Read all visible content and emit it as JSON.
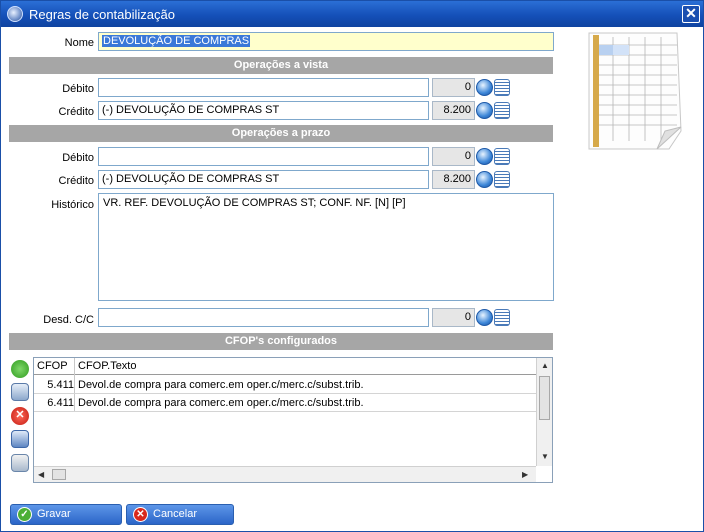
{
  "window": {
    "title": "Regras de contabilização"
  },
  "form": {
    "nome_label": "Nome",
    "nome_value": "DEVOLUÇÃO DE COMPRAS",
    "section_vista": "Operações a vista",
    "section_prazo": "Operações a prazo",
    "debito_label": "Débito",
    "credito_label": "Crédito",
    "vista": {
      "debito_value": "",
      "debito_code": "0",
      "credito_value": "(-) DEVOLUÇÃO DE COMPRAS ST",
      "credito_code": "8.200"
    },
    "prazo": {
      "debito_value": "",
      "debito_code": "0",
      "credito_value": "(-) DEVOLUÇÃO DE COMPRAS ST",
      "credito_code": "8.200"
    },
    "historico_label": "Histórico",
    "historico_value": "VR. REF. DEVOLUÇÃO DE COMPRAS ST; CONF. NF. [N] [P]",
    "desd_label": "Desd. C/C",
    "desd_value": "",
    "desd_code": "0"
  },
  "cfop": {
    "section": "CFOP's configurados",
    "columns": [
      "CFOP",
      "CFOP.Texto"
    ],
    "rows": [
      {
        "cfop": "5.411",
        "texto": "Devol.de compra para comerc.em oper.c/merc.c/subst.trib."
      },
      {
        "cfop": "6.411",
        "texto": "Devol.de compra para comerc.em oper.c/merc.c/subst.trib."
      }
    ]
  },
  "buttons": {
    "gravar": "Gravar",
    "cancelar": "Cancelar"
  },
  "colors": {
    "titlebar": "#1550b8",
    "section": "#a6a6a6",
    "field_border": "#7fa8cc",
    "name_field": "#ffffcc"
  },
  "icons": [
    "app-icon",
    "close-icon",
    "search-icon",
    "list-icon",
    "add-icon",
    "edit-icon",
    "delete-icon",
    "copy-icon",
    "clear-icon",
    "spreadsheet-icon",
    "check-icon",
    "cancel-icon"
  ]
}
